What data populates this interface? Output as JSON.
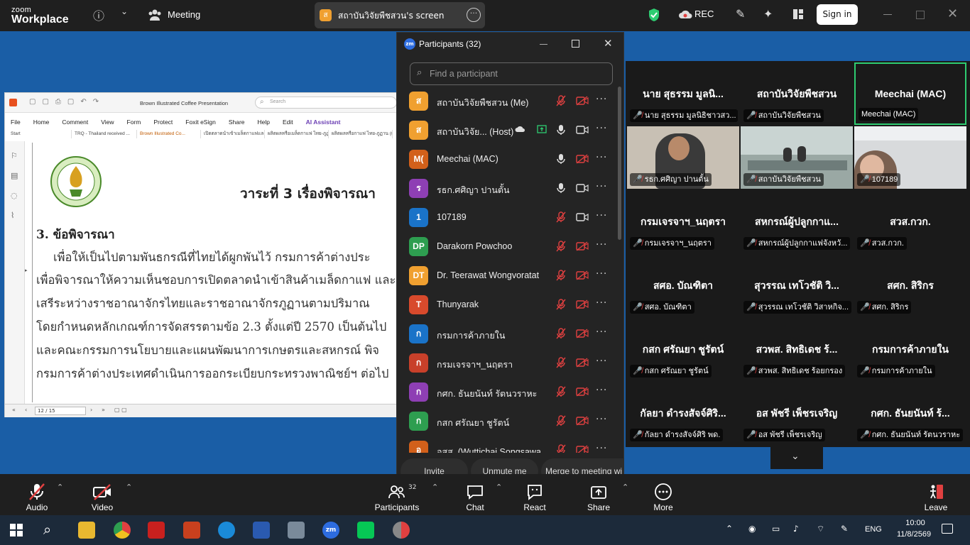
{
  "app": {
    "logo_line1": "zoom",
    "logo_line2": "Workplace",
    "meeting_label": "Meeting",
    "rec_label": "REC",
    "sign_in": "Sign in"
  },
  "share": {
    "badge": "ส",
    "label": "สถาบันวิจัยพืชสวน's screen"
  },
  "pdf": {
    "doc_title": "Brown Illustrated Coffee Presentation",
    "search_placeholder": "Search",
    "menu": [
      "File",
      "Home",
      "Comment",
      "View",
      "Form",
      "Protect",
      "Foxit eSign",
      "Share",
      "Help",
      "Edit",
      "AI Assistant"
    ],
    "tabs": [
      "Start",
      "TRQ - Thailand received ...",
      "Brown Illustrated Co...",
      "เปิดตลาดนำเข้าเมล็ดกาแฟและ...",
      "ผลิตผลหรือเมล็ดกาแฟ ไทย-ภูฏาน (...",
      "ผลิตผลหรือกาแฟ ไทย-ภูฏาน (เอกสาร..."
    ],
    "heading": "วาระที่ 3 เรื่องพิจารณา",
    "section": "3. ข้อพิจารณา",
    "lines": [
      "เพื่อให้เป็นไปตามพันธกรณีที่ไทยได้ผูกพันไว้ กรมการค้าต่างประ",
      "เพื่อพิจารณาให้ความเห็นชอบการเปิดตลาดนำเข้าสินค้าเมล็ดกาแฟ และ",
      "เสรีระหว่างราชอาณาจักรไทยและราชอาณาจักรภูฏานตามปริมาณ",
      "โดยกำหนดหลักเกณฑ์การจัดสรรตามข้อ 2.3 ตั้งแต่ปี 2570 เป็นต้นไป",
      "และคณะกรรมการนโยบายและแผนพัฒนาการเกษตรและสหกรณ์ พิจ",
      "กรมการค้าต่างประเทศดำเนินการออกระเบียบกระทรวงพาณิชย์ฯ ต่อไป"
    ],
    "page_indicator": "12 / 15"
  },
  "participants": {
    "title": "Participants (32)",
    "search_placeholder": "Find a participant",
    "rows": [
      {
        "initials": "ส",
        "color": "#f0a030",
        "name": "สถาบันวิจัยพืชสวน (Me)",
        "mic": "muted",
        "cam": "off"
      },
      {
        "initials": "ส",
        "color": "#f0a030",
        "name": "สถาบันวิจัย... (Host)",
        "mic": "on",
        "cam": "on",
        "sharing": true
      },
      {
        "initials": "M(",
        "color": "#d2601a",
        "name": "Meechai (MAC)",
        "mic": "on",
        "cam": "off"
      },
      {
        "initials": "ร",
        "color": "#8e3fb4",
        "name": "รธก.ศศิญา ปานตั้น",
        "mic": "on",
        "cam": "on"
      },
      {
        "initials": "1",
        "color": "#1a73c8",
        "name": "107189",
        "mic": "muted",
        "cam": "on"
      },
      {
        "initials": "DP",
        "color": "#2e9e50",
        "name": "Darakorn Powchoo",
        "mic": "muted",
        "cam": "off"
      },
      {
        "initials": "DT",
        "color": "#f0a030",
        "name": "Dr. Teerawat Wongvoratat",
        "mic": "muted",
        "cam": "off"
      },
      {
        "initials": "T",
        "color": "#d84a2c",
        "name": "Thunyarak",
        "mic": "muted",
        "cam": "off"
      },
      {
        "initials": "ก",
        "color": "#1a73c8",
        "name": "กรมการค้าภายใน",
        "mic": "muted",
        "cam": "off"
      },
      {
        "initials": "ก",
        "color": "#c8402a",
        "name": "กรมเจรจาฯ_นฤตรา",
        "mic": "muted",
        "cam": "off"
      },
      {
        "initials": "ก",
        "color": "#8e3fb4",
        "name": "กศก. ธันยนันท์ รัตนวราหะ",
        "mic": "muted",
        "cam": "off"
      },
      {
        "initials": "ก",
        "color": "#2e9e50",
        "name": "กสก ศรัณยา ชูรัตน์",
        "mic": "muted",
        "cam": "off"
      },
      {
        "initials": "อ",
        "color": "#d2601a",
        "name": "อสส. (Wuttichai Songsawa...",
        "mic": "muted",
        "cam": "off"
      }
    ],
    "invite": "Invite",
    "unmute_me": "Unmute me",
    "merge": "Merge to meeting wi"
  },
  "gallery": [
    {
      "big": "นาย สุธรรม มูลนิ...",
      "label": "นาย สุธรรม มูลนิธิชาวสว...",
      "type": "name"
    },
    {
      "big": "สถาบันวิจัยพืชสวน",
      "label": "สถาบันวิจัยพืชสวน",
      "type": "name"
    },
    {
      "big": "Meechai (MAC)",
      "label": "Meechai (MAC)",
      "type": "name",
      "active": true
    },
    {
      "big": "",
      "label": "รธก.ศศิญา ปานตั้น",
      "type": "video1"
    },
    {
      "big": "",
      "label": "สถาบันวิจัยพืชสวน",
      "type": "video2"
    },
    {
      "big": "",
      "label": "107189",
      "type": "video3"
    },
    {
      "big": "กรมเจรจาฯ_นฤตรา",
      "label": "กรมเจรจาฯ_นฤตรา",
      "type": "name"
    },
    {
      "big": "สหกรณ์ผู้ปลูกกาแ...",
      "label": "สหกรณ์ผู้ปลูกกาแฟจังหวั...",
      "type": "name"
    },
    {
      "big": "สวส.กวก.",
      "label": "สวส.กวก.",
      "type": "name"
    },
    {
      "big": "สศอ. บัณฑิตา",
      "label": "สศอ. บัณฑิตา",
      "type": "name"
    },
    {
      "big": "สุวรรณ เทโวชัติ วิ...",
      "label": "สุวรรณ เทโวชัติ วิสาหกิจ...",
      "type": "name"
    },
    {
      "big": "สศก. สิริกร",
      "label": "สศก. สิริกร",
      "type": "name"
    },
    {
      "big": "กสก ศรัณยา ชูรัตน์",
      "label": "กสก ศรัณยา ชูรัตน์",
      "type": "name"
    },
    {
      "big": "สวพส. สิทธิเดช ร้...",
      "label": "สวพส. สิทธิเดช ร้อยกรอง",
      "type": "name"
    },
    {
      "big": "กรมการค้าภายใน",
      "label": "กรมการค้าภายใน",
      "type": "name"
    },
    {
      "big": "กัลยา ดำรงสัจจ์ศิริ...",
      "label": "กัลยา ดำรงสัจจ์ศิริ พด.",
      "type": "name"
    },
    {
      "big": "อส พัชรี เพ็ชรเจริญ",
      "label": "อส พัชรี เพ็ชรเจริญ",
      "type": "name"
    },
    {
      "big": "กศก. ธันยนันท์ ร้...",
      "label": "กศก. ธันยนันท์ รัตนวราหะ",
      "type": "name"
    }
  ],
  "toolbar": {
    "audio": "Audio",
    "video": "Video",
    "participants": "Participants",
    "participants_count": "32",
    "chat": "Chat",
    "react": "React",
    "share": "Share",
    "more": "More",
    "leave": "Leave"
  },
  "taskbar": {
    "lang": "ENG",
    "time": "10:00",
    "date": "11/8/2569"
  },
  "colors": {
    "accent_green": "#2ecc71",
    "muted_red": "#e04040",
    "stage_blue": "#1a5ea6"
  }
}
